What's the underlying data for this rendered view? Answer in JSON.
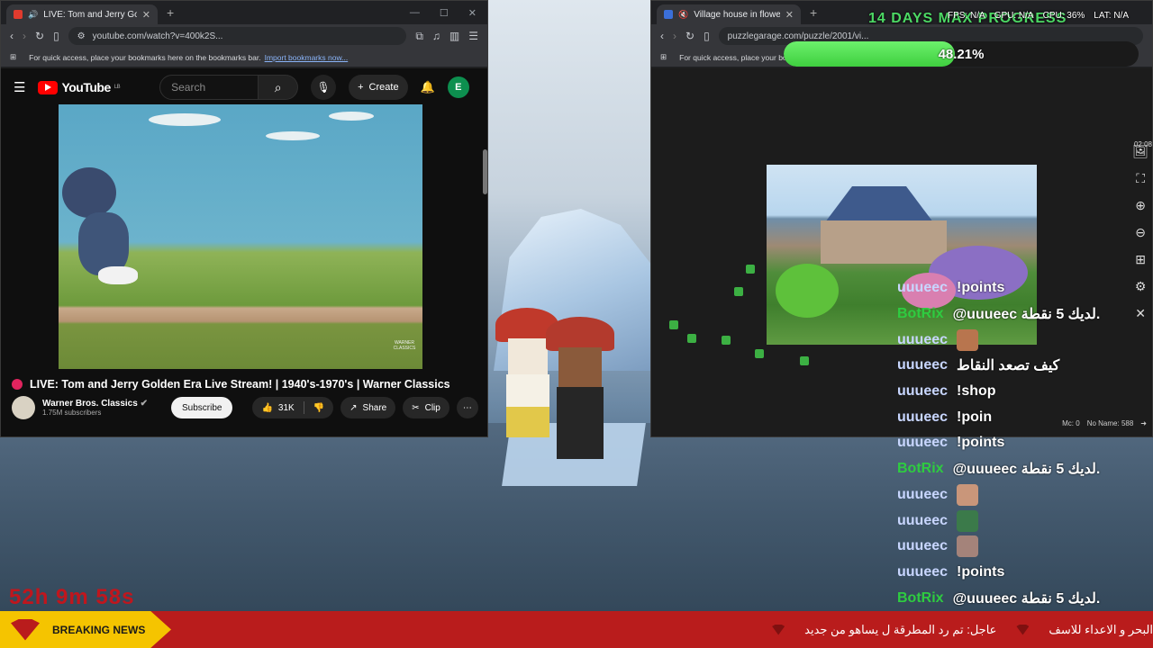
{
  "left_browser": {
    "tab_title": "LIVE: Tom and Jerry Golden Era",
    "url": "youtube.com/watch?v=400k2S...",
    "bookmarks_prompt": "For quick access, place your bookmarks here on the bookmarks bar.",
    "import_link": "Import bookmarks now..."
  },
  "youtube": {
    "logo_text": "YouTube",
    "region_badge": "LB",
    "search_placeholder": "Search",
    "create_label": "Create",
    "avatar_letter": "E",
    "video_title": "LIVE: Tom and Jerry Golden Era Live Stream! | 1940's-1970's | Warner Classics",
    "channel_name": "Warner Bros. Classics",
    "subscribers": "1.75M subscribers",
    "subscribe_label": "Subscribe",
    "likes": "31K",
    "share_label": "Share",
    "clip_label": "Clip",
    "watermark": "WARNER CLASSICS"
  },
  "right_browser": {
    "tab_title": "Village house in flowers Jigsaw",
    "url": "puzzlegarage.com/puzzle/2001/vi...",
    "bookmarks_prompt": "For quick access, place your bo"
  },
  "puzzle": {
    "timer": "02:08",
    "status_left": "Mc: 0",
    "status_right": "No Name: 588"
  },
  "overlay": {
    "progress_title": "14 DAYS MAX PROGRESS",
    "progress_value": 48.21,
    "progress_text": "48.21%",
    "stats": [
      "FPS: N/A",
      "GPU: N/A",
      "CPU: 36%",
      "LAT: N/A"
    ],
    "stream_timer": "52h 9m 58s"
  },
  "chat": [
    {
      "user": "uuueec",
      "msg": "!points",
      "color": "#c8d6ff",
      "emote": false
    },
    {
      "user": "BotRix",
      "msg": "@uuueec لديك 5 نقطة.",
      "color": "#2ecc40",
      "emote": false
    },
    {
      "user": "uuueec",
      "msg": "",
      "color": "#c8d6ff",
      "emote": true,
      "emote_color": "#b8754e"
    },
    {
      "user": "uuueec",
      "msg": "كيف تصعد النقاط",
      "color": "#c8d6ff",
      "emote": false
    },
    {
      "user": "uuueec",
      "msg": "!shop",
      "color": "#c8d6ff",
      "emote": false
    },
    {
      "user": "uuueec",
      "msg": "!poin",
      "color": "#c8d6ff",
      "emote": false
    },
    {
      "user": "uuueec",
      "msg": "!points",
      "color": "#c8d6ff",
      "emote": false
    },
    {
      "user": "BotRix",
      "msg": "@uuueec لديك 5 نقطة.",
      "color": "#2ecc40",
      "emote": false
    },
    {
      "user": "uuueec",
      "msg": "",
      "color": "#c8d6ff",
      "emote": true,
      "emote_color": "#c9967a"
    },
    {
      "user": "uuueec",
      "msg": "",
      "color": "#c8d6ff",
      "emote": true,
      "emote_color": "#3b7a4a"
    },
    {
      "user": "uuueec",
      "msg": "",
      "color": "#c8d6ff",
      "emote": true,
      "emote_color": "#a4837a"
    },
    {
      "user": "uuueec",
      "msg": "!points",
      "color": "#c8d6ff",
      "emote": false
    },
    {
      "user": "BotRix",
      "msg": "@uuueec لديك 5 نقطة.",
      "color": "#2ecc40",
      "emote": false
    }
  ],
  "ticker": {
    "label": "BREAKING NEWS",
    "items": [
      "عاجل: تم رد المطرقة ل يساهو من جديد",
      "البحر و الاعداء للاسف"
    ]
  }
}
